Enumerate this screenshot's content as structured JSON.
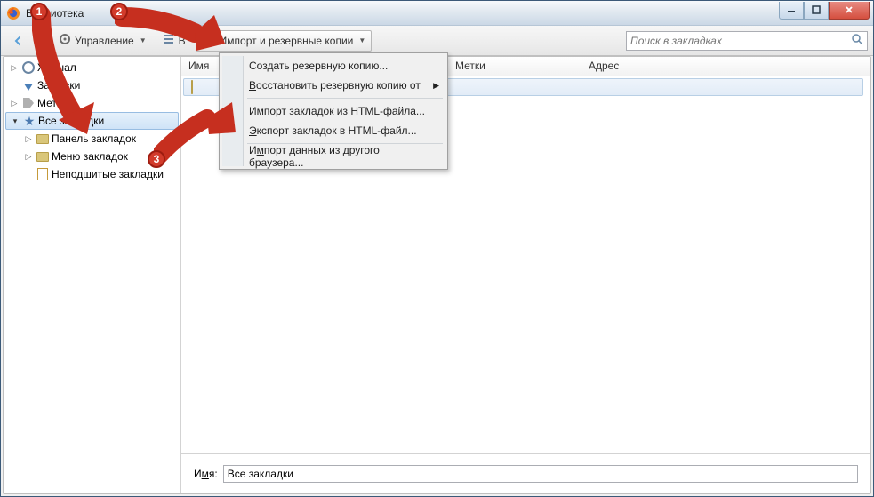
{
  "window": {
    "title": "Библиотека"
  },
  "toolbar": {
    "manage_label": "Управление",
    "views_label": "В",
    "import_label": "Импорт и резервные копии",
    "search_placeholder": "Поиск в закладках"
  },
  "sidebar": {
    "items": [
      {
        "label": "Журнал"
      },
      {
        "label": "Загрузки"
      },
      {
        "label": "Метки"
      },
      {
        "label": "Все закладки"
      },
      {
        "label": "Панель закладок"
      },
      {
        "label": "Меню закладок"
      },
      {
        "label": "Неподшитые закладки"
      }
    ]
  },
  "columns": {
    "name": "Имя",
    "tags": "Метки",
    "address": "Адрес"
  },
  "list": {
    "row0": ""
  },
  "dropdown": {
    "create_backup": "Создать резервную копию...",
    "restore_backup": "Восстановить резервную копию от",
    "import_html": "Импорт закладок из HTML-файла...",
    "export_html": "Экспорт закладок в HTML-файл...",
    "import_browser": "Импорт данных из другого браузера..."
  },
  "form": {
    "name_label_pre": "И",
    "name_label_ul": "м",
    "name_label_post": "я:",
    "name_value": "Все закладки"
  },
  "anno": {
    "n1": "1",
    "n2": "2",
    "n3": "3"
  }
}
